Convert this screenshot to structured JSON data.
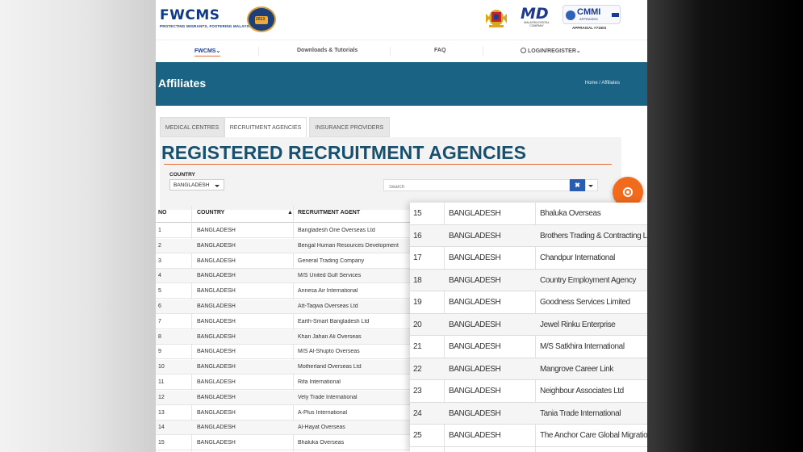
{
  "header": {
    "logo_text": "FWCMS",
    "logo_tagline": "PROTECTING MIGRANTS, FOSTERING MALAYSIA",
    "badge_text": "2013",
    "md_text": "MD",
    "md_sub": "MALAYSIA DIGITAL COMPANY",
    "cmmi_text": "CMMI",
    "cmmi_sub": "APPRAISED",
    "appraisal_text": "APPRAISAL #71503"
  },
  "nav": {
    "items": [
      {
        "label": "FWCMS"
      },
      {
        "label": "Downloads & Tutorials"
      },
      {
        "label": "FAQ"
      },
      {
        "label": "LOGIN/REGISTER"
      }
    ]
  },
  "banner": {
    "title": "Affiliates",
    "breadcrumb": "Home  /  Affiliates"
  },
  "tabs": [
    {
      "label": "MEDICAL CENTRES"
    },
    {
      "label": "RECRUITMENT AGENCIES"
    },
    {
      "label": "INSURANCE PROVIDERS"
    }
  ],
  "section": {
    "title": "REGISTERED RECRUITMENT AGENCIES",
    "country_label": "COUNTRY",
    "country_value": "BANGLADESH",
    "search_placeholder": "Search",
    "clear_label": "✖"
  },
  "table": {
    "headers": {
      "no": "NO",
      "country": "COUNTRY",
      "agent": "RECRUITMENT AGENT"
    },
    "rows": [
      {
        "no": "1",
        "country": "BANGLADESH",
        "agent": "Bangladesh One Overseas Ltd"
      },
      {
        "no": "2",
        "country": "BANGLADESH",
        "agent": "Bengal Human Resources Development"
      },
      {
        "no": "3",
        "country": "BANGLADESH",
        "agent": "General Trading Company"
      },
      {
        "no": "4",
        "country": "BANGLADESH",
        "agent": "M/S United Gulf Services"
      },
      {
        "no": "5",
        "country": "BANGLADESH",
        "agent": "Annesa Air International"
      },
      {
        "no": "6",
        "country": "BANGLADESH",
        "agent": "Att-Taqwa Overseas Ltd"
      },
      {
        "no": "7",
        "country": "BANGLADESH",
        "agent": "Earth-Smart Bangladesh Ltd"
      },
      {
        "no": "8",
        "country": "BANGLADESH",
        "agent": "Khan Jahan Ali Overseas"
      },
      {
        "no": "9",
        "country": "BANGLADESH",
        "agent": "M/S Al-Shupto Overseas"
      },
      {
        "no": "10",
        "country": "BANGLADESH",
        "agent": "Motherland Overseas Ltd"
      },
      {
        "no": "11",
        "country": "BANGLADESH",
        "agent": "Rifa International"
      },
      {
        "no": "12",
        "country": "BANGLADESH",
        "agent": "Vely Trade International"
      },
      {
        "no": "13",
        "country": "BANGLADESH",
        "agent": "A-Plus International"
      },
      {
        "no": "14",
        "country": "BANGLADESH",
        "agent": "Al-Hayat Overseas"
      },
      {
        "no": "15",
        "country": "BANGLADESH",
        "agent": "Bhaluka Overseas"
      }
    ]
  },
  "zoom_rows": [
    {
      "no": "15",
      "country": "BANGLADESH",
      "agent": "Bhaluka Overseas"
    },
    {
      "no": "16",
      "country": "BANGLADESH",
      "agent": "Brothers Trading & Contracting Ltd"
    },
    {
      "no": "17",
      "country": "BANGLADESH",
      "agent": "Chandpur International"
    },
    {
      "no": "18",
      "country": "BANGLADESH",
      "agent": "Country Employment Agency"
    },
    {
      "no": "19",
      "country": "BANGLADESH",
      "agent": "Goodness Services Limited"
    },
    {
      "no": "20",
      "country": "BANGLADESH",
      "agent": "Jewel Rinku Enterprise"
    },
    {
      "no": "21",
      "country": "BANGLADESH",
      "agent": "M/S Satkhira International"
    },
    {
      "no": "22",
      "country": "BANGLADESH",
      "agent": "Mangrove Career Link"
    },
    {
      "no": "23",
      "country": "BANGLADESH",
      "agent": "Neighbour Associates Ltd"
    },
    {
      "no": "24",
      "country": "BANGLADESH",
      "agent": "Tania Trade International"
    },
    {
      "no": "25",
      "country": "BANGLADESH",
      "agent": "The Anchor Care Global Migration"
    }
  ],
  "colors": {
    "brand_blue": "#1c3b8f",
    "banner_teal": "#1a6384",
    "accent_orange": "#f26a1b",
    "title_teal": "#17506e"
  }
}
